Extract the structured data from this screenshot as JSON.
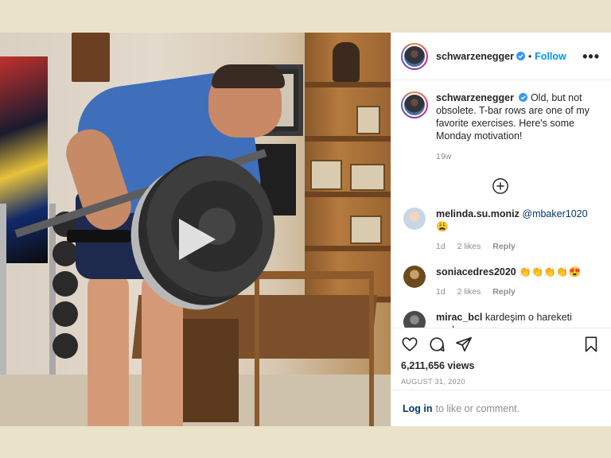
{
  "post": {
    "username": "schwarzenegger",
    "follow_label": "Follow",
    "dot": "•",
    "more_label": "•••",
    "caption_text": "Old, but not obsolete. T-bar rows are one of my favorite exercises. Here's some Monday motivation!",
    "caption_time": "19w",
    "views": "6,211,656 views",
    "date": "August 31, 2020"
  },
  "comments": [
    {
      "username": "melinda.su.moniz",
      "mention": "@mbaker1020",
      "text": " 😩",
      "time": "1d",
      "likes": "2 likes",
      "reply": "Reply",
      "avatar_color": "#c9d6e3"
    },
    {
      "username": "soniacedres2020",
      "mention": "",
      "text": " 👏👏👏👏😍",
      "time": "1d",
      "likes": "2 likes",
      "reply": "Reply",
      "avatar_color": "#6b4a1c"
    },
    {
      "username": "mirac_bcl",
      "mention": "",
      "text": " kardeşim o hareketi yanlış yapıyosun",
      "time": "",
      "likes": "",
      "reply": "",
      "avatar_color": "#4a4a4a"
    }
  ],
  "login": {
    "link": "Log in",
    "text": "to like or comment."
  },
  "icons": [
    "heart-icon",
    "comment-icon",
    "share-icon",
    "save-icon",
    "play-icon",
    "add-circle-icon",
    "verified-badge-icon",
    "more-options-icon"
  ],
  "colors": {
    "accent": "#0095f6",
    "background": "#eae2c9",
    "muted": "#8e8e8e",
    "link": "#00376b"
  }
}
